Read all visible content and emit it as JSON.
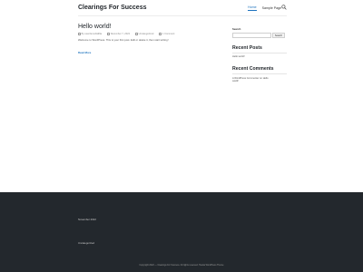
{
  "header": {
    "site_title": "Clearings For Success",
    "nav": [
      {
        "label": "Home",
        "active": true
      },
      {
        "label": "Sample Page",
        "active": false
      }
    ],
    "search_icon": "search-icon"
  },
  "post": {
    "title": "Hello world!",
    "meta": {
      "author": "By userdemo0a99a",
      "date": "November 7, 2022",
      "category": "Uncategorized",
      "comments": "1 Comment"
    },
    "excerpt": "Welcome to WordPress. This is your first post. Edit or delete it, then start writing!",
    "read_more": "Read More"
  },
  "sidebar": {
    "search_label": "Search",
    "search_button": "Search",
    "search_value": "",
    "recent_posts_heading": "Recent Posts",
    "recent_posts": [
      "Hello world!"
    ],
    "recent_comments_heading": "Recent Comments",
    "recent_comment": {
      "author": "A WordPress Commenter",
      "connector": " on ",
      "post": "Hello world!"
    }
  },
  "footer": {
    "archive": "November 2022",
    "category": "Uncategorized",
    "copyright": "Copyright 2022 — Clearings For Success. All rights reserved. Hestia WordPress Theme"
  },
  "colors": {
    "accent": "#1e73be",
    "footer_bg": "#23282d"
  }
}
